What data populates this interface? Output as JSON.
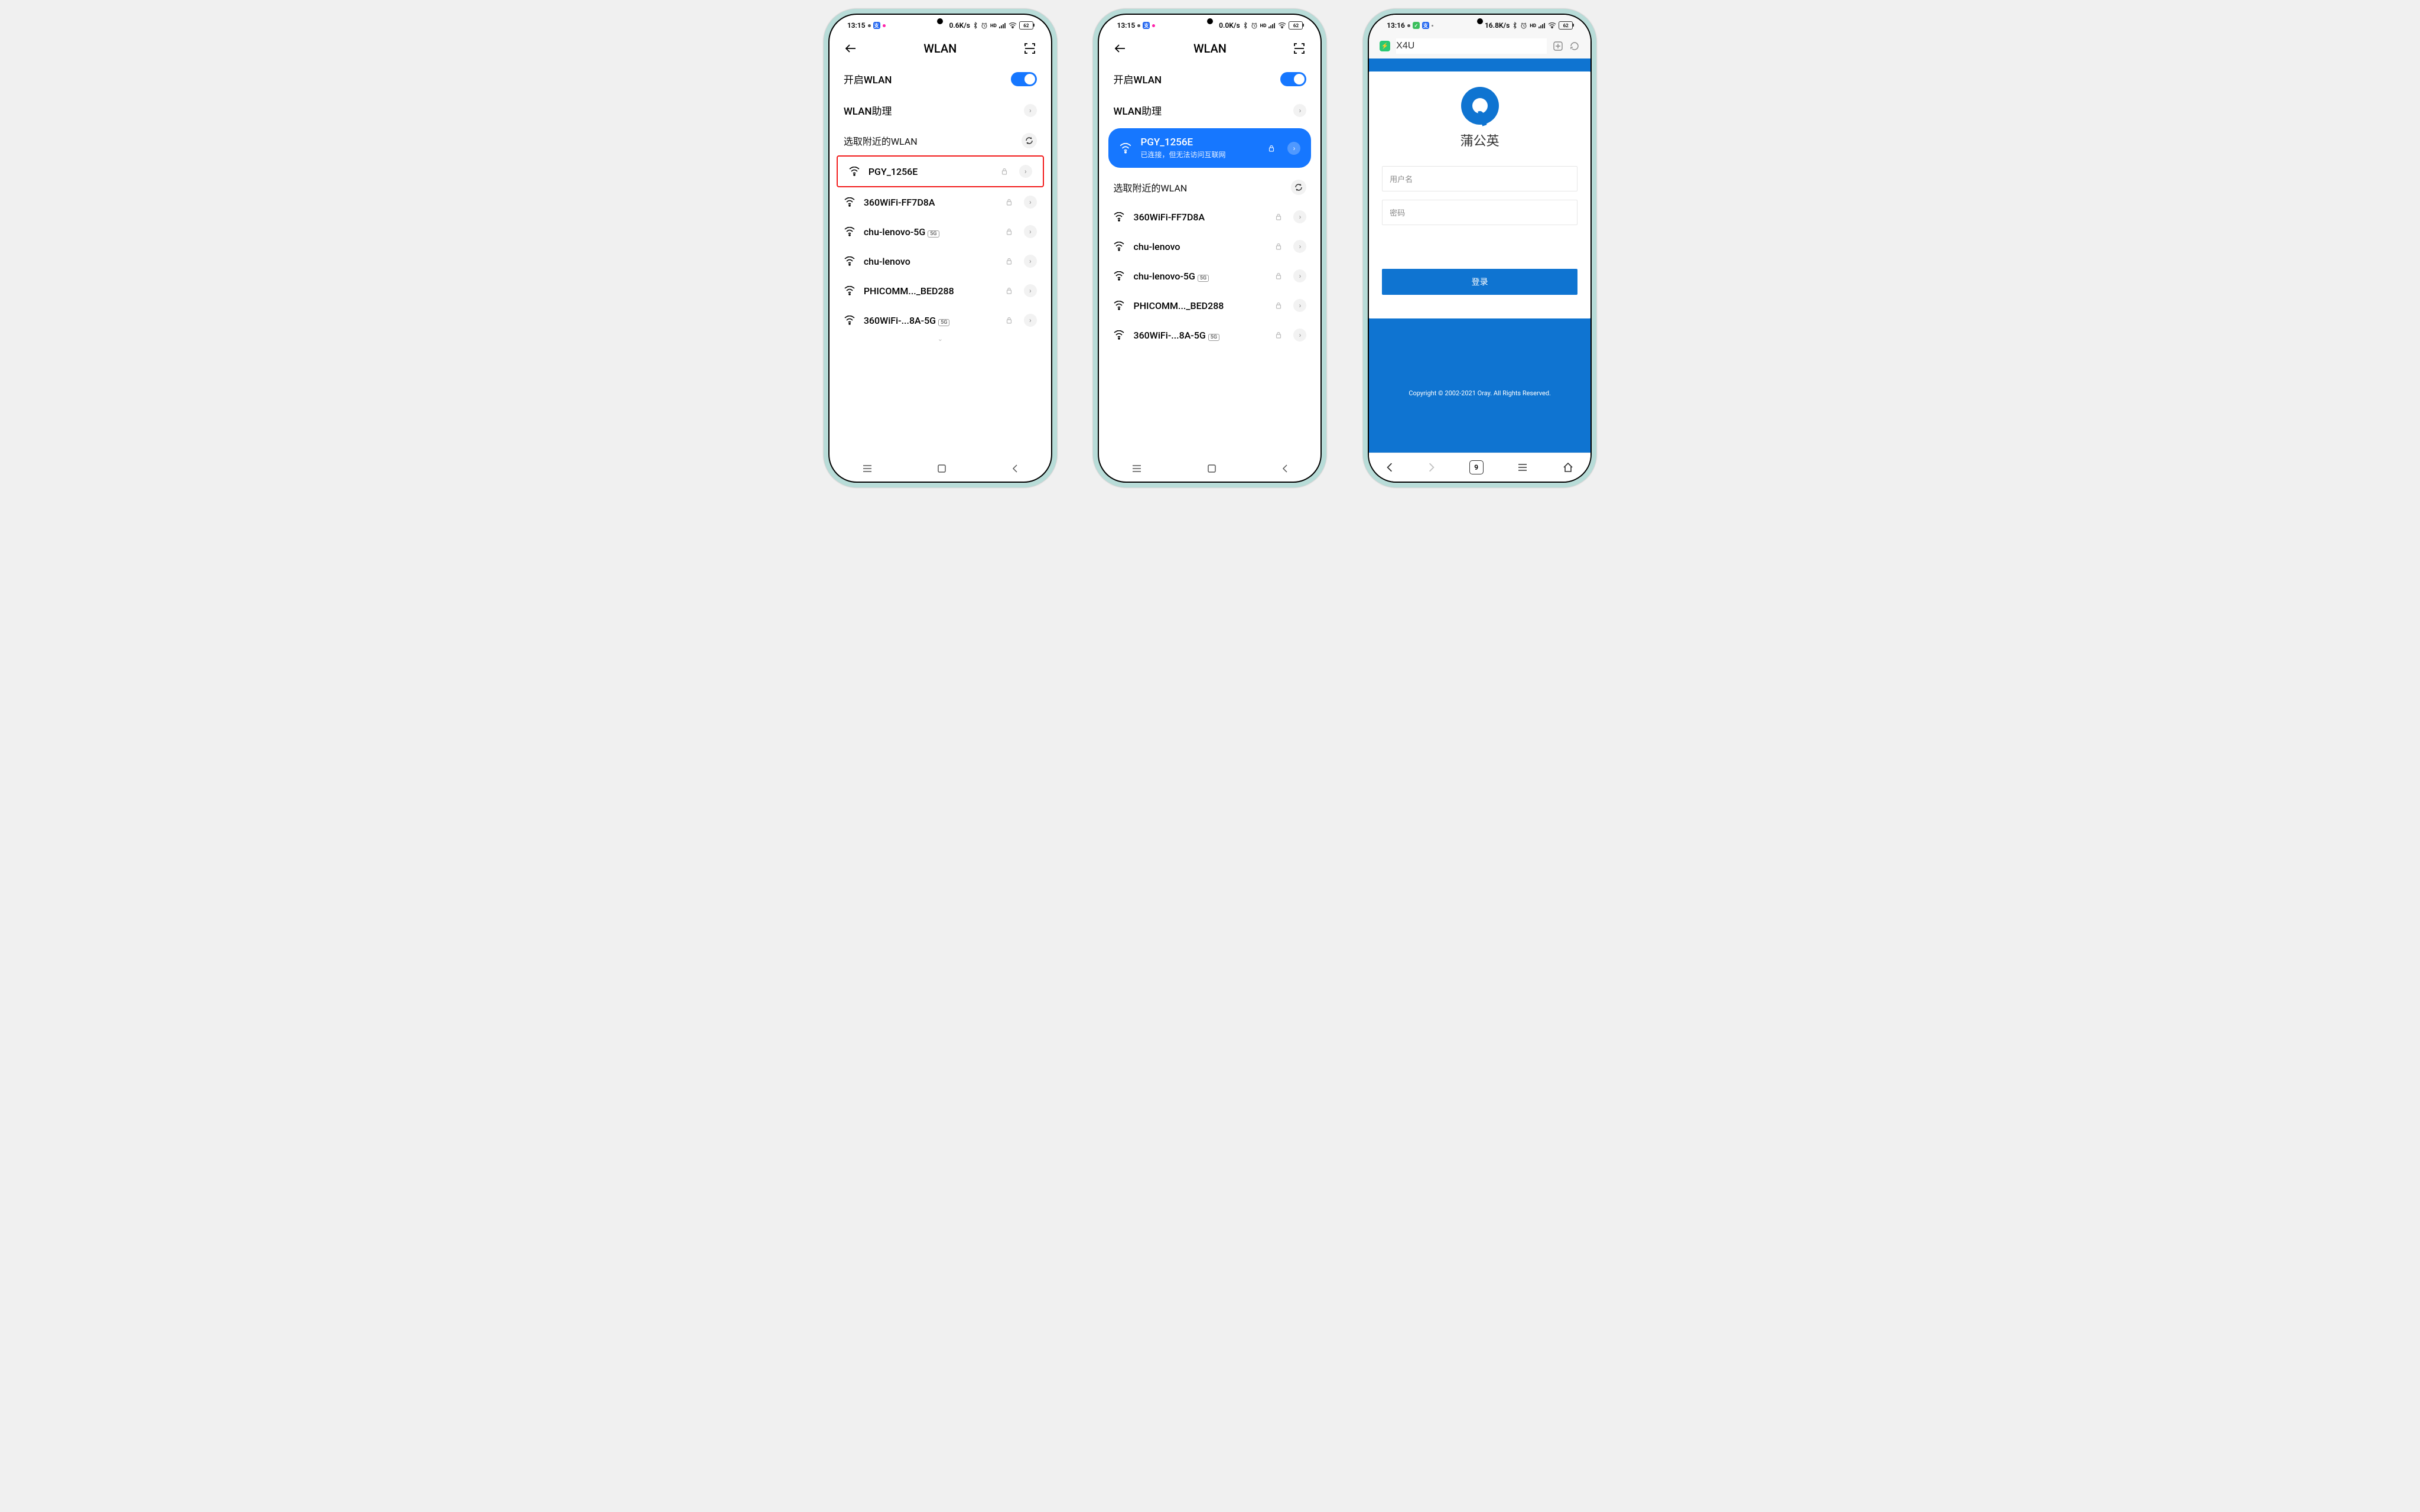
{
  "colors": {
    "accent": "#1677ff",
    "danger": "#f21c1c",
    "brand_blue": "#0f74d1"
  },
  "phone1": {
    "status": {
      "time": "13:15",
      "speed": "0.6K/s",
      "battery": "62"
    },
    "title": "WLAN",
    "enable_label": "开启WLAN",
    "assistant_label": "WLAN助理",
    "nearby_label": "选取附近的WLAN",
    "highlight_network": "PGY_1256E",
    "networks": [
      {
        "ssid": "360WiFi-FF7D8A",
        "band": ""
      },
      {
        "ssid": "chu-lenovo-5G",
        "band": "5G"
      },
      {
        "ssid": "chu-lenovo",
        "band": ""
      },
      {
        "ssid": "PHICOMM..._BED288",
        "band": ""
      },
      {
        "ssid": "360WiFi-...8A-5G",
        "band": "5G"
      }
    ]
  },
  "phone2": {
    "status": {
      "time": "13:15",
      "speed": "0.0K/s",
      "battery": "62"
    },
    "title": "WLAN",
    "enable_label": "开启WLAN",
    "assistant_label": "WLAN助理",
    "connected": {
      "ssid": "PGY_1256E",
      "sub": "已连接，但无法访问互联网"
    },
    "nearby_label": "选取附近的WLAN",
    "networks": [
      {
        "ssid": "360WiFi-FF7D8A",
        "band": ""
      },
      {
        "ssid": "chu-lenovo",
        "band": ""
      },
      {
        "ssid": "chu-lenovo-5G",
        "band": "5G"
      },
      {
        "ssid": "PHICOMM..._BED288",
        "band": ""
      },
      {
        "ssid": "360WiFi-...8A-5G",
        "band": "5G"
      }
    ]
  },
  "phone3": {
    "status": {
      "time": "13:16",
      "speed": "16.8K/s",
      "battery": "62"
    },
    "url": "X4U",
    "brand": "蒲公英",
    "username_ph": "用户名",
    "password_ph": "密码",
    "login_label": "登录",
    "copyright": "Copyright © 2002-2021 Oray. All Rights Reserved.",
    "tab_count": "9"
  }
}
